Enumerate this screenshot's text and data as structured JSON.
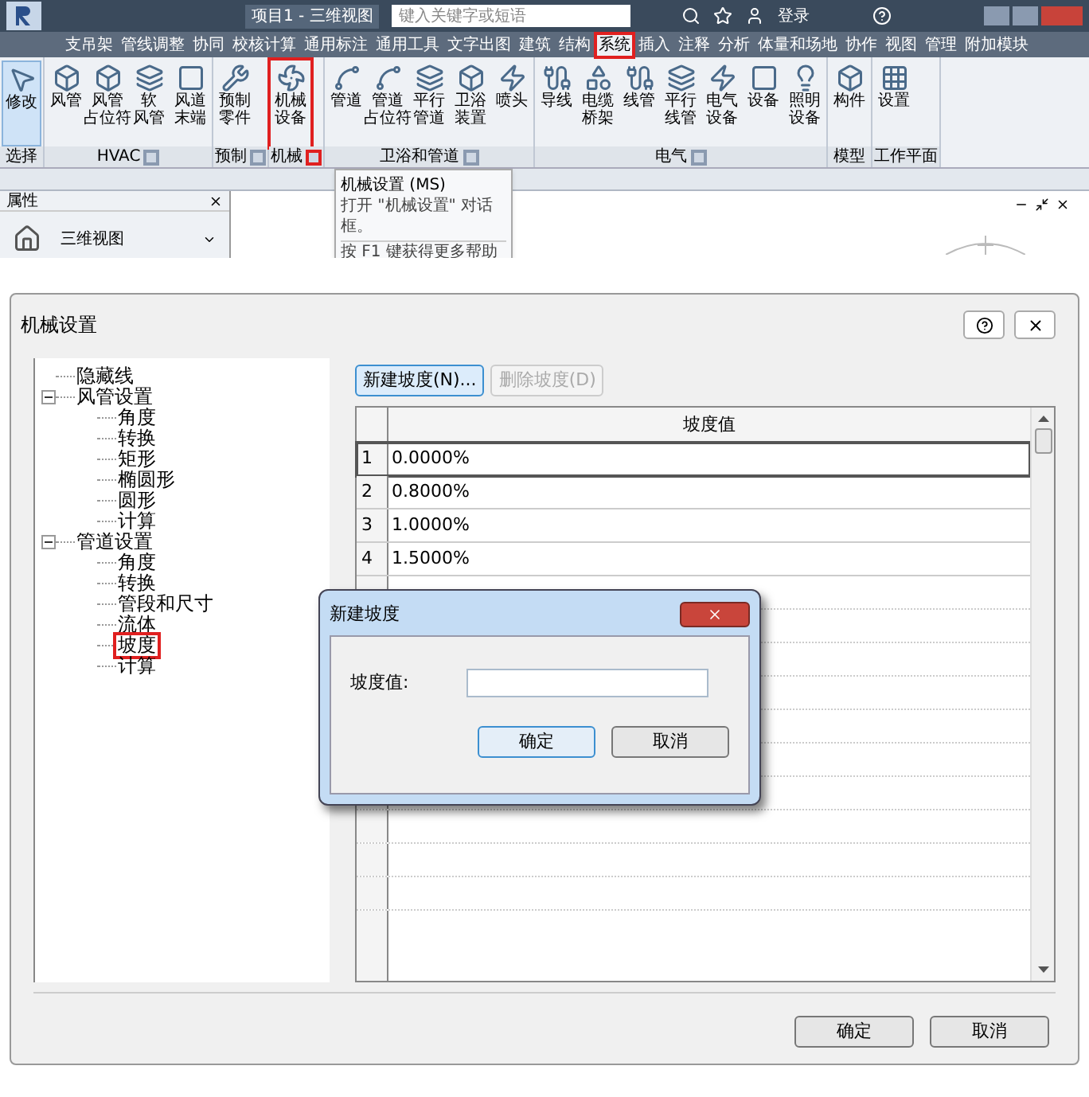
{
  "app": {
    "title": "项目1 - 三维视图",
    "search": {
      "placeholder": "键入关键字或短语"
    },
    "login": "登录",
    "tabs": [
      {
        "label": "支吊架",
        "selected": false,
        "highlighted": false
      },
      {
        "label": "管线调整",
        "selected": false,
        "highlighted": false
      },
      {
        "label": "协同",
        "selected": false,
        "highlighted": false
      },
      {
        "label": "校核计算",
        "selected": false,
        "highlighted": false
      },
      {
        "label": "通用标注",
        "selected": false,
        "highlighted": false
      },
      {
        "label": "通用工具",
        "selected": false,
        "highlighted": false
      },
      {
        "label": "文字出图",
        "selected": false,
        "highlighted": false
      },
      {
        "label": "建筑",
        "selected": false,
        "highlighted": false
      },
      {
        "label": "结构",
        "selected": false,
        "highlighted": false
      },
      {
        "label": "系统",
        "selected": true,
        "highlighted": true
      },
      {
        "label": "插入",
        "selected": false,
        "highlighted": false
      },
      {
        "label": "注释",
        "selected": false,
        "highlighted": false
      },
      {
        "label": "分析",
        "selected": false,
        "highlighted": false
      },
      {
        "label": "体量和场地",
        "selected": false,
        "highlighted": false
      },
      {
        "label": "协作",
        "selected": false,
        "highlighted": false
      },
      {
        "label": "视图",
        "selected": false,
        "highlighted": false
      },
      {
        "label": "管理",
        "selected": false,
        "highlighted": false
      },
      {
        "label": "附加模块",
        "selected": false,
        "highlighted": false
      }
    ],
    "panels": [
      {
        "label": "选择",
        "tools": [
          {
            "label": [
              "修改"
            ],
            "selected": true,
            "highlighted": false
          }
        ]
      },
      {
        "label": "HVAC",
        "launcher": {
          "highlighted": false
        },
        "tools": [
          {
            "label": [
              "风管"
            ],
            "selected": false,
            "highlighted": false
          },
          {
            "label": [
              "风管",
              "占位符"
            ],
            "selected": false,
            "highlighted": false
          },
          {
            "label": [
              "软",
              "风管"
            ],
            "selected": false,
            "highlighted": false
          },
          {
            "label": [
              "风道",
              "末端"
            ],
            "selected": false,
            "highlighted": false
          }
        ]
      },
      {
        "label": "预制",
        "launcher": {
          "highlighted": false
        },
        "tools": [
          {
            "label": [
              "预制",
              "零件"
            ],
            "selected": false,
            "highlighted": false
          }
        ]
      },
      {
        "label": "机械",
        "launcher": {
          "highlighted": true
        },
        "tools": [
          {
            "label": [
              "机械",
              "设备"
            ],
            "selected": false,
            "highlighted": true
          }
        ]
      },
      {
        "label": "卫浴和管道",
        "launcher": {
          "highlighted": false
        },
        "tools": [
          {
            "label": [
              "管道"
            ],
            "selected": false,
            "highlighted": false
          },
          {
            "label": [
              "管道",
              "占位符"
            ],
            "selected": false,
            "highlighted": false
          },
          {
            "label": [
              "平行",
              "管道"
            ],
            "selected": false,
            "highlighted": false
          },
          {
            "label": [
              "卫浴",
              "装置"
            ],
            "selected": false,
            "highlighted": false
          },
          {
            "label": [
              "喷头"
            ],
            "selected": false,
            "highlighted": false
          }
        ]
      },
      {
        "label": "电气",
        "launcher": {
          "highlighted": false
        },
        "tools": [
          {
            "label": [
              "导线"
            ],
            "selected": false,
            "highlighted": false
          },
          {
            "label": [
              "电缆",
              "桥架"
            ],
            "selected": false,
            "highlighted": false
          },
          {
            "label": [
              "线管"
            ],
            "selected": false,
            "highlighted": false
          },
          {
            "label": [
              "平行",
              "线管"
            ],
            "selected": false,
            "highlighted": false
          },
          {
            "label": [
              "电气",
              "设备"
            ],
            "selected": false,
            "highlighted": false
          },
          {
            "label": [
              "设备"
            ],
            "selected": false,
            "highlighted": false
          },
          {
            "label": [
              "照明",
              "设备"
            ],
            "selected": false,
            "highlighted": false
          }
        ]
      },
      {
        "label": "模型",
        "tools": [
          {
            "label": [
              "构件"
            ],
            "selected": false,
            "highlighted": false
          }
        ]
      },
      {
        "label": "工作平面",
        "tools": [
          {
            "label": [
              "设置"
            ],
            "selected": false,
            "highlighted": false
          }
        ]
      }
    ],
    "tooltip": {
      "title": "机械设置 (MS)",
      "description": "打开 \"机械设置\" 对话框。",
      "help": "按 F1 键获得更多帮助"
    },
    "properties": {
      "title": "属性",
      "view_type": "三维视图"
    }
  },
  "dialog": {
    "title": "机械设置",
    "tree": [
      {
        "label": "隐藏线",
        "highlighted": false
      },
      {
        "label": "风管设置",
        "expanded": true,
        "highlighted": false,
        "children": [
          {
            "label": "角度",
            "highlighted": false
          },
          {
            "label": "转换",
            "highlighted": false
          },
          {
            "label": "矩形",
            "highlighted": false
          },
          {
            "label": "椭圆形",
            "highlighted": false
          },
          {
            "label": "圆形",
            "highlighted": false
          },
          {
            "label": "计算",
            "highlighted": false
          }
        ]
      },
      {
        "label": "管道设置",
        "expanded": true,
        "highlighted": false,
        "children": [
          {
            "label": "角度",
            "highlighted": false
          },
          {
            "label": "转换",
            "highlighted": false
          },
          {
            "label": "管段和尺寸",
            "highlighted": false
          },
          {
            "label": "流体",
            "highlighted": false
          },
          {
            "label": "坡度",
            "highlighted": true
          },
          {
            "label": "计算",
            "highlighted": false
          }
        ]
      }
    ],
    "actions": [
      {
        "label": "新建坡度(N)...",
        "disabled": false
      },
      {
        "label": "删除坡度(D)",
        "disabled": true
      }
    ],
    "table": {
      "column": "坡度值",
      "rows": [
        {
          "index": "1",
          "value": "0.0000%",
          "selected": true
        },
        {
          "index": "2",
          "value": "0.8000%",
          "selected": false
        },
        {
          "index": "3",
          "value": "1.0000%",
          "selected": false
        },
        {
          "index": "4",
          "value": "1.5000%",
          "selected": false
        }
      ]
    },
    "buttons": [
      "确定",
      "取消"
    ]
  },
  "subdialog": {
    "title": "新建坡度",
    "field_label": "坡度值:",
    "buttons": [
      "确定",
      "取消"
    ]
  }
}
